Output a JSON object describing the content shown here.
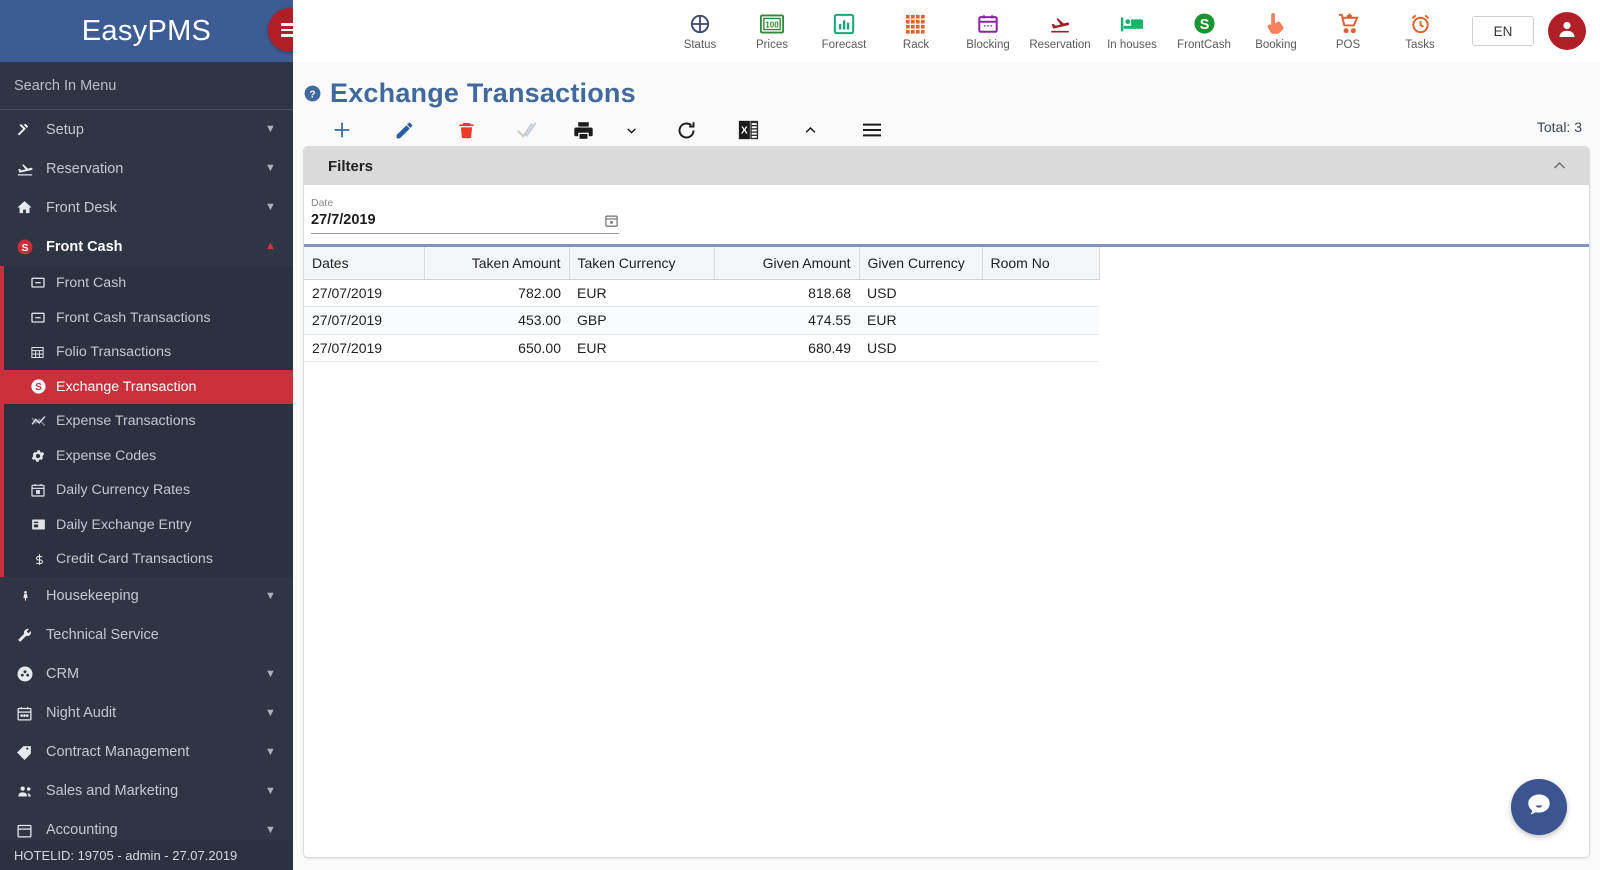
{
  "brand": {
    "name": "EasyPMS",
    "menu_toggle_icon": "hamburger-icon"
  },
  "search": {
    "placeholder": "Search In Menu",
    "value": ""
  },
  "sidebar": {
    "items": [
      {
        "label": "Setup",
        "icon": "tools-icon",
        "expandable": true,
        "expanded": false
      },
      {
        "label": "Reservation",
        "icon": "plane-landing-icon",
        "expandable": true,
        "expanded": false
      },
      {
        "label": "Front Desk",
        "icon": "home-icon",
        "expandable": true,
        "expanded": false
      },
      {
        "label": "Front Cash",
        "icon": "dollar-circle-icon",
        "expandable": true,
        "expanded": true
      }
    ],
    "front_cash_submenu": [
      {
        "label": "Front Cash",
        "icon": "minus-box-icon",
        "active": false
      },
      {
        "label": "Front Cash Transactions",
        "icon": "minus-box-icon",
        "active": false
      },
      {
        "label": "Folio Transactions",
        "icon": "grid-icon",
        "active": false
      },
      {
        "label": "Exchange Transaction",
        "icon": "dollar-circle-icon",
        "active": true
      },
      {
        "label": "Expense Transactions",
        "icon": "chart-line-icon",
        "active": false
      },
      {
        "label": "Expense Codes",
        "icon": "gear-icon",
        "active": false
      },
      {
        "label": "Daily Currency Rates",
        "icon": "calendar-icon",
        "active": false
      },
      {
        "label": "Daily Exchange Entry",
        "icon": "card-icon",
        "active": false
      },
      {
        "label": "Credit Card Transactions",
        "icon": "dollar-sign-icon",
        "active": false
      }
    ],
    "items_after": [
      {
        "label": "Housekeeping",
        "icon": "person-icon",
        "expandable": true,
        "expanded": false
      },
      {
        "label": "Technical Service",
        "icon": "wrench-icon",
        "expandable": false,
        "expanded": false
      },
      {
        "label": "CRM",
        "icon": "users-circle-icon",
        "expandable": true,
        "expanded": false
      },
      {
        "label": "Night Audit",
        "icon": "calendar-icon",
        "expandable": true,
        "expanded": false
      },
      {
        "label": "Contract Management",
        "icon": "tag-icon",
        "expandable": true,
        "expanded": false
      },
      {
        "label": "Sales and Marketing",
        "icon": "people-icon",
        "expandable": true,
        "expanded": false
      },
      {
        "label": "Accounting",
        "icon": "calendar-icon",
        "expandable": true,
        "expanded": false
      }
    ],
    "footer": "HOTELID: 19705 - admin - 27.07.2019"
  },
  "topnav": {
    "tiles": [
      {
        "label": "Status",
        "icon": "pie-chart-icon",
        "color": "#3b4a72"
      },
      {
        "label": "Prices",
        "icon": "money-100-icon",
        "color": "#2f8a37"
      },
      {
        "label": "Forecast",
        "icon": "bar-chart-icon",
        "color": "#17a67a"
      },
      {
        "label": "Rack",
        "icon": "grid-squares-icon",
        "color": "#e2602a"
      },
      {
        "label": "Blocking",
        "icon": "calendar-icon",
        "color": "#8c24a8"
      },
      {
        "label": "Reservation",
        "icon": "plane-landing-icon",
        "color": "#9e1f26"
      },
      {
        "label": "In houses",
        "icon": "bed-icon",
        "color": "#16b36a"
      },
      {
        "label": "FrontCash",
        "icon": "dollar-circle-icon",
        "color": "#1a9431"
      },
      {
        "label": "Booking",
        "icon": "hand-click-icon",
        "color": "#f4825c"
      },
      {
        "label": "POS",
        "icon": "cart-plus-icon",
        "color": "#e2602a"
      },
      {
        "label": "Tasks",
        "icon": "alarm-clock-icon",
        "color": "#e2602a"
      }
    ],
    "language": "EN",
    "avatar_icon": "user-avatar-icon"
  },
  "page": {
    "help_icon": "question-circle-icon",
    "title": "Exchange Transactions",
    "total_label": "Total: 3"
  },
  "toolbar": {
    "buttons": [
      {
        "name": "add-button",
        "icon": "plus-icon",
        "color": "#3f6fb5"
      },
      {
        "name": "edit-button",
        "icon": "pencil-icon",
        "color": "#2e5e9e"
      },
      {
        "name": "delete-button",
        "icon": "trash-icon",
        "color": "#f0392b"
      },
      {
        "name": "approve-button",
        "icon": "double-check-icon",
        "color": "#c8cdd4"
      },
      {
        "name": "print-button",
        "icon": "printer-icon",
        "color": "#1b1b1b"
      },
      {
        "name": "print-dropdown-button",
        "icon": "chevron-down-icon",
        "color": "#1b1b1b"
      },
      {
        "name": "refresh-button",
        "icon": "refresh-icon",
        "color": "#1b1b1b"
      },
      {
        "name": "export-excel-button",
        "icon": "excel-icon",
        "color": "#1b6b3f"
      },
      {
        "name": "collapse-button",
        "icon": "chevron-up-icon",
        "color": "#1b1b1b"
      },
      {
        "name": "menu-button",
        "icon": "hamburger-icon",
        "color": "#1b1b1b"
      }
    ]
  },
  "filters": {
    "title": "Filters",
    "collapse_icon": "chevron-up-icon",
    "date_field": {
      "label": "Date",
      "value": "27/7/2019",
      "placeholder": "DD/M/YYYY",
      "calendar_icon": "calendar-icon"
    }
  },
  "grid": {
    "columns": [
      {
        "key": "date",
        "label": "Dates",
        "align": "left"
      },
      {
        "key": "taken_amount",
        "label": "Taken Amount",
        "align": "right"
      },
      {
        "key": "taken_currency",
        "label": "Taken Currency",
        "align": "left"
      },
      {
        "key": "given_amount",
        "label": "Given Amount",
        "align": "right"
      },
      {
        "key": "given_currency",
        "label": "Given Currency",
        "align": "left"
      },
      {
        "key": "room_no",
        "label": "Room No",
        "align": "left"
      }
    ],
    "rows": [
      {
        "date": "27/07/2019",
        "taken_amount": "782.00",
        "taken_currency": "EUR",
        "given_amount": "818.68",
        "given_currency": "USD",
        "room_no": ""
      },
      {
        "date": "27/07/2019",
        "taken_amount": "453.00",
        "taken_currency": "GBP",
        "given_amount": "474.55",
        "given_currency": "EUR",
        "room_no": ""
      },
      {
        "date": "27/07/2019",
        "taken_amount": "650.00",
        "taken_currency": "EUR",
        "given_amount": "680.49",
        "given_currency": "USD",
        "room_no": ""
      }
    ]
  },
  "chat": {
    "icon": "chat-bubble-icon",
    "color": "#3c5590"
  },
  "colors": {
    "brand_blue": "#3e5c94",
    "sidebar_dark": "#2f3545",
    "accent_red": "#c9303c",
    "title_blue": "#41699d",
    "filters_grey": "#dadada",
    "filter_underline": "#8194bb"
  }
}
